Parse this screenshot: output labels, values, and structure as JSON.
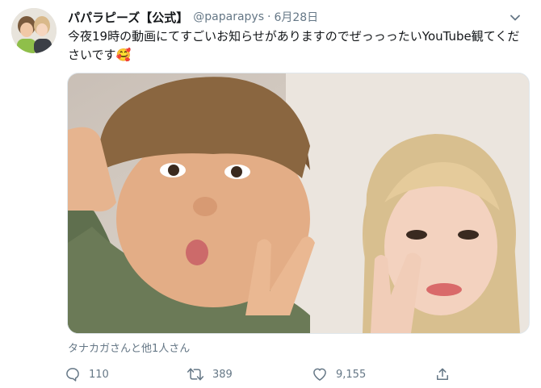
{
  "tweet": {
    "display_name": "パパラピーズ【公式】",
    "handle": "@paparapys",
    "separator": "·",
    "date": "6月28日",
    "text": "今夜19時の動画にてすごいお知らせがありますのでぜっっったいYouTube観てくださいです🥰",
    "tagged": "タナカガさんと他1人さん"
  },
  "actions": {
    "reply_count": "110",
    "retweet_count": "389",
    "like_count": "9,155"
  },
  "icons": {
    "more": "chevron-down-icon",
    "reply": "reply-icon",
    "retweet": "retweet-icon",
    "like": "heart-icon",
    "share": "share-icon"
  },
  "colors": {
    "text": "#14171a",
    "secondary": "#657786",
    "border": "#e1e8ed"
  }
}
